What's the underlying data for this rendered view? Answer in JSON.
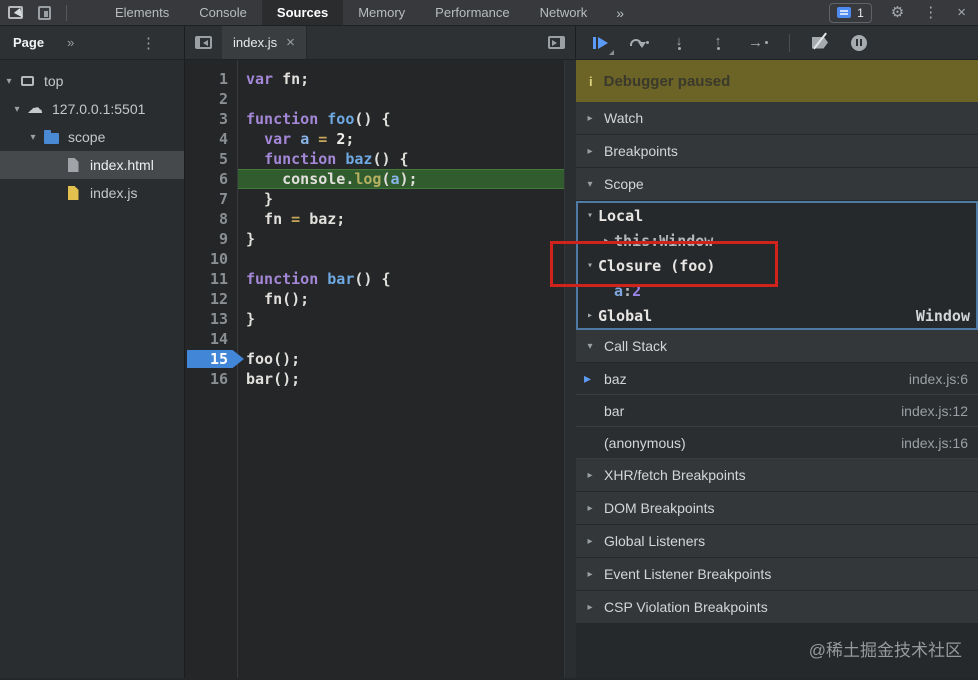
{
  "topbar": {
    "tabs": [
      "Elements",
      "Console",
      "Sources",
      "Memory",
      "Performance",
      "Network"
    ],
    "active_tab": "Sources",
    "more_label": "»",
    "issues_count": "1",
    "gear_glyph": "⚙",
    "menu_glyph": "⋮",
    "close_glyph": "×"
  },
  "navigator": {
    "tab_label": "Page",
    "more_label": "»",
    "menu_glyph": "⋮",
    "tree": [
      {
        "label": "top",
        "icon": "frame",
        "glyph": "",
        "indent": 0,
        "expander": "▾",
        "selected": false
      },
      {
        "label": "127.0.0.1:5501",
        "icon": "cloud",
        "glyph": "☁",
        "indent": 1,
        "expander": "▾",
        "selected": false
      },
      {
        "label": "scope",
        "icon": "folder",
        "glyph": "",
        "indent": 2,
        "expander": "▾",
        "selected": false
      },
      {
        "label": "index.html",
        "icon": "file-html",
        "glyph": "",
        "indent": 3,
        "expander": "",
        "selected": true
      },
      {
        "label": "index.js",
        "icon": "file-js",
        "glyph": "",
        "indent": 3,
        "expander": "",
        "selected": false
      }
    ]
  },
  "editor": {
    "tab_label": "index.js",
    "tab_close_glyph": "×",
    "current_line": 6,
    "breakpoint_line": 15,
    "lines": [
      {
        "n": 1,
        "tokens": [
          [
            "kw",
            "var"
          ],
          [
            "plain",
            " fn;"
          ]
        ]
      },
      {
        "n": 2,
        "tokens": []
      },
      {
        "n": 3,
        "tokens": [
          [
            "kw",
            "function"
          ],
          [
            "fn",
            " foo"
          ],
          [
            "plain",
            "() {"
          ]
        ]
      },
      {
        "n": 4,
        "tokens": [
          [
            "plain",
            "  "
          ],
          [
            "kw",
            "var"
          ],
          [
            "plain",
            " "
          ],
          [
            "var",
            "a"
          ],
          [
            "plain",
            " "
          ],
          [
            "op",
            "="
          ],
          [
            "plain",
            " "
          ],
          [
            "num",
            "2"
          ],
          [
            "plain",
            ";"
          ]
        ]
      },
      {
        "n": 5,
        "tokens": [
          [
            "plain",
            "  "
          ],
          [
            "kw",
            "function"
          ],
          [
            "fn",
            " baz"
          ],
          [
            "plain",
            "() {"
          ]
        ]
      },
      {
        "n": 6,
        "tokens": [
          [
            "plain",
            "    console."
          ],
          [
            "prop",
            "log"
          ],
          [
            "plain",
            "("
          ],
          [
            "var",
            "a"
          ],
          [
            "plain",
            ");"
          ]
        ]
      },
      {
        "n": 7,
        "tokens": [
          [
            "plain",
            "  }"
          ]
        ]
      },
      {
        "n": 8,
        "tokens": [
          [
            "plain",
            "  fn "
          ],
          [
            "op",
            "="
          ],
          [
            "plain",
            " baz;"
          ]
        ]
      },
      {
        "n": 9,
        "tokens": [
          [
            "plain",
            "}"
          ]
        ]
      },
      {
        "n": 10,
        "tokens": []
      },
      {
        "n": 11,
        "tokens": [
          [
            "kw",
            "function"
          ],
          [
            "fn",
            " bar"
          ],
          [
            "plain",
            "() {"
          ]
        ]
      },
      {
        "n": 12,
        "tokens": [
          [
            "plain",
            "  fn();"
          ]
        ]
      },
      {
        "n": 13,
        "tokens": [
          [
            "plain",
            "}"
          ]
        ]
      },
      {
        "n": 14,
        "tokens": []
      },
      {
        "n": 15,
        "tokens": [
          [
            "plain",
            "foo();"
          ]
        ]
      },
      {
        "n": 16,
        "tokens": [
          [
            "plain",
            "bar();"
          ]
        ]
      }
    ]
  },
  "debugger_panel": {
    "banner_icon": "i",
    "banner_label": "Debugger paused",
    "sections_top": [
      {
        "label": "Watch",
        "expander": "▸"
      },
      {
        "label": "Breakpoints",
        "expander": "▸"
      }
    ],
    "scope_label": "Scope",
    "scope_expander": "▾",
    "scope_rows": [
      {
        "exp": "▾",
        "name": "Local",
        "name_class": "title",
        "sep": "",
        "value": "",
        "value_class": "",
        "right": "",
        "indent": 0
      },
      {
        "exp": "▸",
        "name": "this",
        "name_class": "dim",
        "sep": ": ",
        "value": "Window",
        "value_class": "dim",
        "right": "",
        "indent": 1
      },
      {
        "exp": "▾",
        "name": "Closure (foo)",
        "name_class": "title",
        "sep": "",
        "value": "",
        "value_class": "",
        "right": "",
        "indent": 0
      },
      {
        "exp": "",
        "name": "a",
        "name_class": "key",
        "sep": ": ",
        "value": "2",
        "value_class": "num",
        "right": "",
        "indent": 1
      },
      {
        "exp": "▸",
        "name": "Global",
        "name_class": "title",
        "sep": "",
        "value": "",
        "value_class": "",
        "right": "Window",
        "indent": 0
      }
    ],
    "callstack_label": "Call Stack",
    "callstack_expander": "▾",
    "callstack": [
      {
        "name": "baz",
        "loc": "index.js:6",
        "active": true,
        "marker": "▸"
      },
      {
        "name": "bar",
        "loc": "index.js:12",
        "active": false,
        "marker": ""
      },
      {
        "name": "(anonymous)",
        "loc": "index.js:16",
        "active": false,
        "marker": ""
      }
    ],
    "sections_bottom": [
      {
        "label": "XHR/fetch Breakpoints",
        "expander": "▸"
      },
      {
        "label": "DOM Breakpoints",
        "expander": "▸"
      },
      {
        "label": "Global Listeners",
        "expander": "▸"
      },
      {
        "label": "Event Listener Breakpoints",
        "expander": "▸"
      },
      {
        "label": "CSP Violation Breakpoints",
        "expander": "▸"
      }
    ]
  },
  "debug_toolbar_icons": [
    {
      "name": "resume-script",
      "kind": "resume"
    },
    {
      "name": "step-over",
      "kind": "step-over"
    },
    {
      "name": "step-into",
      "kind": "dot-arrow",
      "glyph": "↓"
    },
    {
      "name": "step-out",
      "kind": "dot-arrow",
      "glyph": "↑"
    },
    {
      "name": "step",
      "kind": "arrow-dot",
      "glyph": "→"
    },
    {
      "name": "divider",
      "kind": "divider"
    },
    {
      "name": "deactivate-breakpoints",
      "kind": "deactivate"
    },
    {
      "name": "pause-on-exceptions",
      "kind": "pause-circle"
    }
  ],
  "watermark": "@稀土掘金技术社区",
  "colors": {
    "accent_blue": "#4286d8",
    "resume_blue": "#5b9bf8",
    "paused_banner_olive": "#6b6426",
    "exec_line_green": "#315c2e",
    "annotation_red": "#cf231b",
    "scope_focus_blue": "#4d7ba6",
    "folder_blue": "#4a8ad4",
    "js_file_yellow": "#e2c14f"
  }
}
